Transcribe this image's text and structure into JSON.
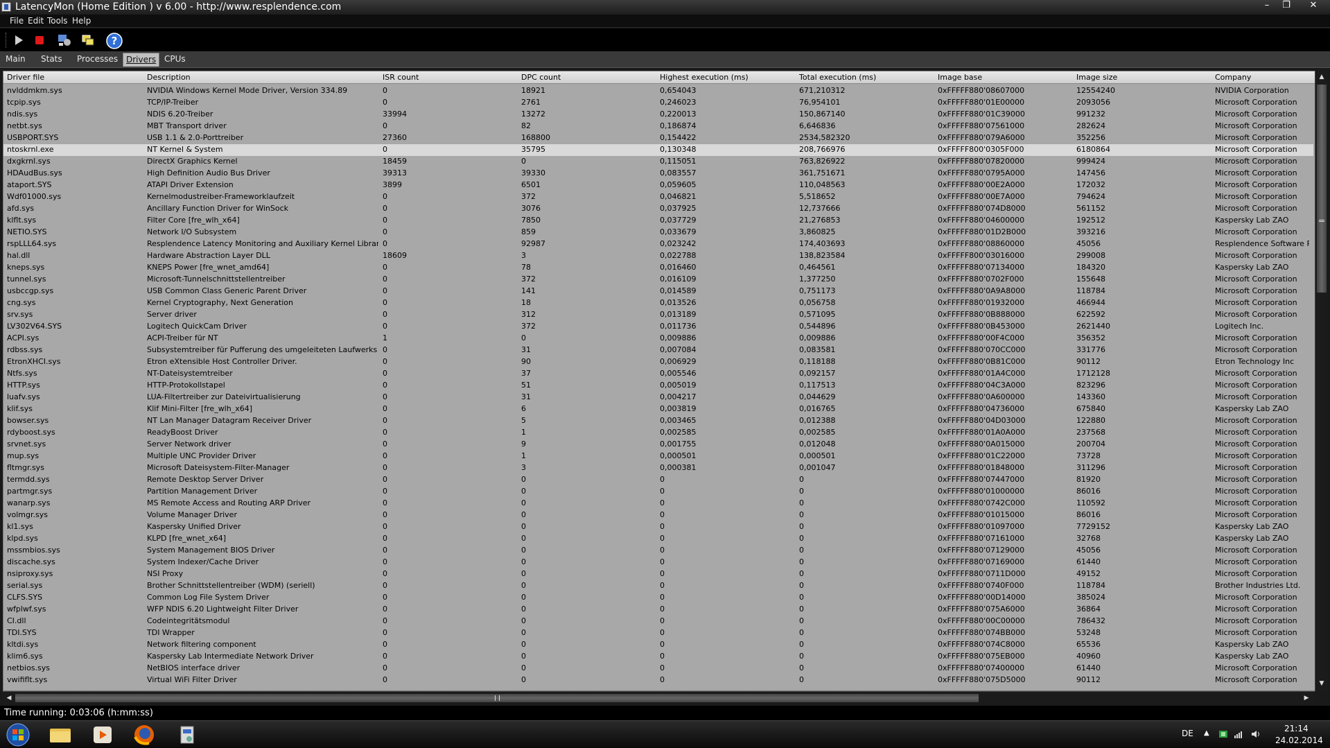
{
  "window": {
    "title": "LatencyMon  (Home Edition )  v 6.00 - http://www.resplendence.com",
    "controls": [
      "–",
      "❐",
      "✕"
    ]
  },
  "menu": [
    "File",
    "Edit",
    "Tools",
    "Help"
  ],
  "toolbar": {
    "buttons": [
      "play-icon",
      "stop-icon",
      "process-settings-icon",
      "windows-icon",
      "help-icon"
    ]
  },
  "tabs": [
    {
      "label": "Main",
      "active": false
    },
    {
      "label": "Stats",
      "active": false
    },
    {
      "label": "Processes",
      "active": false
    },
    {
      "label": "Drivers",
      "active": true
    },
    {
      "label": "CPUs",
      "active": false
    }
  ],
  "table": {
    "columns": [
      "Driver file",
      "Description",
      "ISR count",
      "DPC count",
      "Highest execution (ms)",
      "Total execution (ms)",
      "Image base",
      "Image size",
      "Company"
    ],
    "selected_row": 5,
    "rows": [
      [
        "nvlddmkm.sys",
        "NVIDIA Windows Kernel Mode Driver, Version 334.89",
        "0",
        "18921",
        "0,654043",
        "671,210312",
        "0xFFFFF880'08607000",
        "12554240",
        "NVIDIA Corporation"
      ],
      [
        "tcpip.sys",
        "TCP/IP-Treiber",
        "0",
        "2761",
        "0,246023",
        "76,954101",
        "0xFFFFF880'01E00000",
        "2093056",
        "Microsoft Corporation"
      ],
      [
        "ndis.sys",
        "NDIS 6.20-Treiber",
        "33994",
        "13272",
        "0,220013",
        "150,867140",
        "0xFFFFF880'01C39000",
        "991232",
        "Microsoft Corporation"
      ],
      [
        "netbt.sys",
        "MBT Transport driver",
        "0",
        "82",
        "0,186874",
        "6,646836",
        "0xFFFFF880'07561000",
        "282624",
        "Microsoft Corporation"
      ],
      [
        "USBPORT.SYS",
        "USB 1.1 & 2.0-Porttreiber",
        "27360",
        "168800",
        "0,154422",
        "2534,582320",
        "0xFFFFF880'079A6000",
        "352256",
        "Microsoft Corporation"
      ],
      [
        "ntoskrnl.exe",
        "NT Kernel & System",
        "0",
        "35795",
        "0,130348",
        "208,766976",
        "0xFFFFF800'0305F000",
        "6180864",
        "Microsoft Corporation"
      ],
      [
        "dxgkrnl.sys",
        "DirectX Graphics Kernel",
        "18459",
        "0",
        "0,115051",
        "763,826922",
        "0xFFFFF880'07820000",
        "999424",
        "Microsoft Corporation"
      ],
      [
        "HDAudBus.sys",
        "High Definition Audio Bus Driver",
        "39313",
        "39330",
        "0,083557",
        "361,751671",
        "0xFFFFF880'0795A000",
        "147456",
        "Microsoft Corporation"
      ],
      [
        "ataport.SYS",
        "ATAPI Driver Extension",
        "3899",
        "6501",
        "0,059605",
        "110,048563",
        "0xFFFFF880'00E2A000",
        "172032",
        "Microsoft Corporation"
      ],
      [
        "Wdf01000.sys",
        "Kernelmodustreiber-Frameworklaufzeit",
        "0",
        "372",
        "0,046821",
        "5,518652",
        "0xFFFFF880'00E7A000",
        "794624",
        "Microsoft Corporation"
      ],
      [
        "afd.sys",
        "Ancillary Function Driver for WinSock",
        "0",
        "3076",
        "0,037925",
        "12,737666",
        "0xFFFFF880'074D8000",
        "561152",
        "Microsoft Corporation"
      ],
      [
        "klflt.sys",
        "Filter Core [fre_wlh_x64]",
        "0",
        "7850",
        "0,037729",
        "21,276853",
        "0xFFFFF880'04600000",
        "192512",
        "Kaspersky Lab ZAO"
      ],
      [
        "NETIO.SYS",
        "Network I/O Subsystem",
        "0",
        "859",
        "0,033679",
        "3,860825",
        "0xFFFFF880'01D2B000",
        "393216",
        "Microsoft Corporation"
      ],
      [
        "rspLLL64.sys",
        "Resplendence Latency Monitoring and Auxiliary Kernel Library",
        "0",
        "92987",
        "0,023242",
        "174,403693",
        "0xFFFFF880'08860000",
        "45056",
        "Resplendence Software Projec"
      ],
      [
        "hal.dll",
        "Hardware Abstraction Layer DLL",
        "18609",
        "3",
        "0,022788",
        "138,823584",
        "0xFFFFF800'03016000",
        "299008",
        "Microsoft Corporation"
      ],
      [
        "kneps.sys",
        "KNEPS Power [fre_wnet_amd64]",
        "0",
        "78",
        "0,016460",
        "0,464561",
        "0xFFFFF880'07134000",
        "184320",
        "Kaspersky Lab ZAO"
      ],
      [
        "tunnel.sys",
        "Microsoft-Tunnelschnittstellentreiber",
        "0",
        "372",
        "0,016109",
        "1,377250",
        "0xFFFFF880'0702F000",
        "155648",
        "Microsoft Corporation"
      ],
      [
        "usbccgp.sys",
        "USB Common Class Generic Parent Driver",
        "0",
        "141",
        "0,014589",
        "0,751173",
        "0xFFFFF880'0A9A8000",
        "118784",
        "Microsoft Corporation"
      ],
      [
        "cng.sys",
        "Kernel Cryptography, Next Generation",
        "0",
        "18",
        "0,013526",
        "0,056758",
        "0xFFFFF880'01932000",
        "466944",
        "Microsoft Corporation"
      ],
      [
        "srv.sys",
        "Server driver",
        "0",
        "312",
        "0,013189",
        "0,571095",
        "0xFFFFF880'0B888000",
        "622592",
        "Microsoft Corporation"
      ],
      [
        "LV302V64.SYS",
        "Logitech QuickCam Driver",
        "0",
        "372",
        "0,011736",
        "0,544896",
        "0xFFFFF880'0B453000",
        "2621440",
        "Logitech Inc."
      ],
      [
        "ACPI.sys",
        "ACPI-Treiber für NT",
        "1",
        "0",
        "0,009886",
        "0,009886",
        "0xFFFFF880'00F4C000",
        "356352",
        "Microsoft Corporation"
      ],
      [
        "rdbss.sys",
        "Subsystemtreiber für Pufferung des umgeleiteten Laufwerks",
        "0",
        "31",
        "0,007084",
        "0,083581",
        "0xFFFFF880'070CC000",
        "331776",
        "Microsoft Corporation"
      ],
      [
        "EtronXHCI.sys",
        "Etron eXtensible Host Controller Driver.",
        "0",
        "90",
        "0,006929",
        "0,118188",
        "0xFFFFF880'0B81C000",
        "90112",
        "Etron Technology Inc"
      ],
      [
        "Ntfs.sys",
        "NT-Dateisystemtreiber",
        "0",
        "37",
        "0,005546",
        "0,092157",
        "0xFFFFF880'01A4C000",
        "1712128",
        "Microsoft Corporation"
      ],
      [
        "HTTP.sys",
        "HTTP-Protokollstapel",
        "0",
        "51",
        "0,005019",
        "0,117513",
        "0xFFFFF880'04C3A000",
        "823296",
        "Microsoft Corporation"
      ],
      [
        "luafv.sys",
        "LUA-Filtertreiber zur Dateivirtualisierung",
        "0",
        "31",
        "0,004217",
        "0,044629",
        "0xFFFFF880'0A600000",
        "143360",
        "Microsoft Corporation"
      ],
      [
        "klif.sys",
        "Klif Mini-Filter [fre_wlh_x64]",
        "0",
        "6",
        "0,003819",
        "0,016765",
        "0xFFFFF880'04736000",
        "675840",
        "Kaspersky Lab ZAO"
      ],
      [
        "bowser.sys",
        "NT Lan Manager Datagram Receiver Driver",
        "0",
        "5",
        "0,003465",
        "0,012388",
        "0xFFFFF880'04D03000",
        "122880",
        "Microsoft Corporation"
      ],
      [
        "rdyboost.sys",
        "ReadyBoost Driver",
        "0",
        "1",
        "0,002585",
        "0,002585",
        "0xFFFFF880'01A0A000",
        "237568",
        "Microsoft Corporation"
      ],
      [
        "srvnet.sys",
        "Server Network driver",
        "0",
        "9",
        "0,001755",
        "0,012048",
        "0xFFFFF880'0A015000",
        "200704",
        "Microsoft Corporation"
      ],
      [
        "mup.sys",
        "Multiple UNC Provider Driver",
        "0",
        "1",
        "0,000501",
        "0,000501",
        "0xFFFFF880'01C22000",
        "73728",
        "Microsoft Corporation"
      ],
      [
        "fltmgr.sys",
        "Microsoft Dateisystem-Filter-Manager",
        "0",
        "3",
        "0,000381",
        "0,001047",
        "0xFFFFF880'01848000",
        "311296",
        "Microsoft Corporation"
      ],
      [
        "termdd.sys",
        "Remote Desktop Server Driver",
        "0",
        "0",
        "0",
        "0",
        "0xFFFFF880'07447000",
        "81920",
        "Microsoft Corporation"
      ],
      [
        "partmgr.sys",
        "Partition Management Driver",
        "0",
        "0",
        "0",
        "0",
        "0xFFFFF880'01000000",
        "86016",
        "Microsoft Corporation"
      ],
      [
        "wanarp.sys",
        "MS Remote Access and Routing ARP Driver",
        "0",
        "0",
        "0",
        "0",
        "0xFFFFF880'0742C000",
        "110592",
        "Microsoft Corporation"
      ],
      [
        "volmgr.sys",
        "Volume Manager Driver",
        "0",
        "0",
        "0",
        "0",
        "0xFFFFF880'01015000",
        "86016",
        "Microsoft Corporation"
      ],
      [
        "kl1.sys",
        "Kaspersky Unified Driver",
        "0",
        "0",
        "0",
        "0",
        "0xFFFFF880'01097000",
        "7729152",
        "Kaspersky Lab ZAO"
      ],
      [
        "klpd.sys",
        "KLPD [fre_wnet_x64]",
        "0",
        "0",
        "0",
        "0",
        "0xFFFFF880'07161000",
        "32768",
        "Kaspersky Lab ZAO"
      ],
      [
        "mssmbios.sys",
        "System Management BIOS Driver",
        "0",
        "0",
        "0",
        "0",
        "0xFFFFF880'07129000",
        "45056",
        "Microsoft Corporation"
      ],
      [
        "discache.sys",
        "System Indexer/Cache Driver",
        "0",
        "0",
        "0",
        "0",
        "0xFFFFF880'07169000",
        "61440",
        "Microsoft Corporation"
      ],
      [
        "nsiproxy.sys",
        "NSI Proxy",
        "0",
        "0",
        "0",
        "0",
        "0xFFFFF880'0711D000",
        "49152",
        "Microsoft Corporation"
      ],
      [
        "serial.sys",
        "Brother Schnittstellentreiber (WDM) (seriell)",
        "0",
        "0",
        "0",
        "0",
        "0xFFFFF880'0740F000",
        "118784",
        "Brother Industries Ltd."
      ],
      [
        "CLFS.SYS",
        "Common Log File System Driver",
        "0",
        "0",
        "0",
        "0",
        "0xFFFFF880'00D14000",
        "385024",
        "Microsoft Corporation"
      ],
      [
        "wfplwf.sys",
        "WFP NDIS 6.20 Lightweight Filter Driver",
        "0",
        "0",
        "0",
        "0",
        "0xFFFFF880'075A6000",
        "36864",
        "Microsoft Corporation"
      ],
      [
        "CI.dll",
        "Codeintegritätsmodul",
        "0",
        "0",
        "0",
        "0",
        "0xFFFFF880'00C00000",
        "786432",
        "Microsoft Corporation"
      ],
      [
        "TDI.SYS",
        "TDI Wrapper",
        "0",
        "0",
        "0",
        "0",
        "0xFFFFF880'074BB000",
        "53248",
        "Microsoft Corporation"
      ],
      [
        "kltdi.sys",
        "Network filtering component",
        "0",
        "0",
        "0",
        "0",
        "0xFFFFF880'074C8000",
        "65536",
        "Kaspersky Lab ZAO"
      ],
      [
        "klim6.sys",
        "Kaspersky Lab Intermediate Network Driver",
        "0",
        "0",
        "0",
        "0",
        "0xFFFFF880'075EB000",
        "40960",
        "Kaspersky Lab ZAO"
      ],
      [
        "netbios.sys",
        "NetBIOS interface driver",
        "0",
        "0",
        "0",
        "0",
        "0xFFFFF880'07400000",
        "61440",
        "Microsoft Corporation"
      ],
      [
        "vwififlt.sys",
        "Virtual WiFi Filter Driver",
        "0",
        "0",
        "0",
        "0",
        "0xFFFFF880'075D5000",
        "90112",
        "Microsoft Corporation"
      ]
    ]
  },
  "status": {
    "text": "Time running: 0:03:06  (h:mm:ss)"
  },
  "taskbar": {
    "items": [
      "windows-start-icon",
      "explorer-icon",
      "media-player-icon",
      "firefox-icon",
      "latencymon-icon"
    ],
    "language": "DE",
    "time": "21:14",
    "date": "24.02.2014"
  }
}
